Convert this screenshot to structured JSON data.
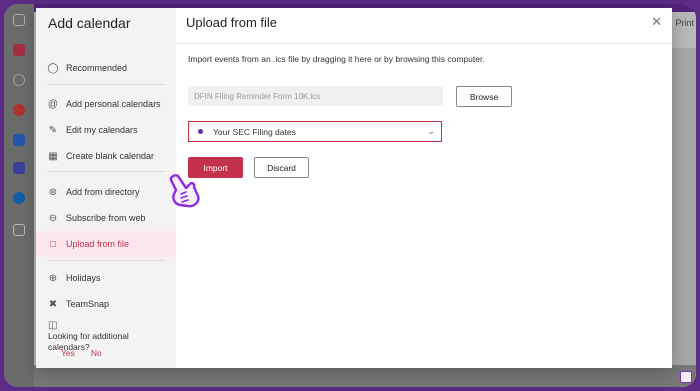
{
  "app": {
    "right_toolbar_label": "Print"
  },
  "dialog": {
    "sidebar": {
      "title": "Add calendar",
      "items": [
        {
          "label": "Recommended",
          "icon": "lightbulb-icon"
        },
        {
          "label": "Add personal calendars",
          "icon": "at-sign-icon"
        },
        {
          "label": "Edit my calendars",
          "icon": "edit-calendar-icon"
        },
        {
          "label": "Create blank calendar",
          "icon": "calendar-icon"
        },
        {
          "label": "Add from directory",
          "icon": "people-search-icon"
        },
        {
          "label": "Subscribe from web",
          "icon": "globe-link-icon"
        },
        {
          "label": "Upload from file",
          "icon": "file-icon",
          "active": true
        },
        {
          "label": "Holidays",
          "icon": "globe-icon"
        },
        {
          "label": "TeamSnap",
          "icon": "teamsnap-icon"
        }
      ],
      "question": "Looking for additional calendars?",
      "yes_label": "Yes",
      "no_label": "No"
    },
    "main": {
      "title": "Upload from file",
      "description": "Import events from an .ics file by dragging it here or by browsing this computer.",
      "file_value": "DFIN Filing Reminder  Form 10K.ics",
      "browse_label": "Browse",
      "calendar_select": "Your SEC Filing dates",
      "import_label": "Import",
      "discard_label": "Discard"
    }
  },
  "colors": {
    "accent": "#c4314b",
    "frame": "#6a2d9c",
    "active_bg": "#fde7ec"
  }
}
